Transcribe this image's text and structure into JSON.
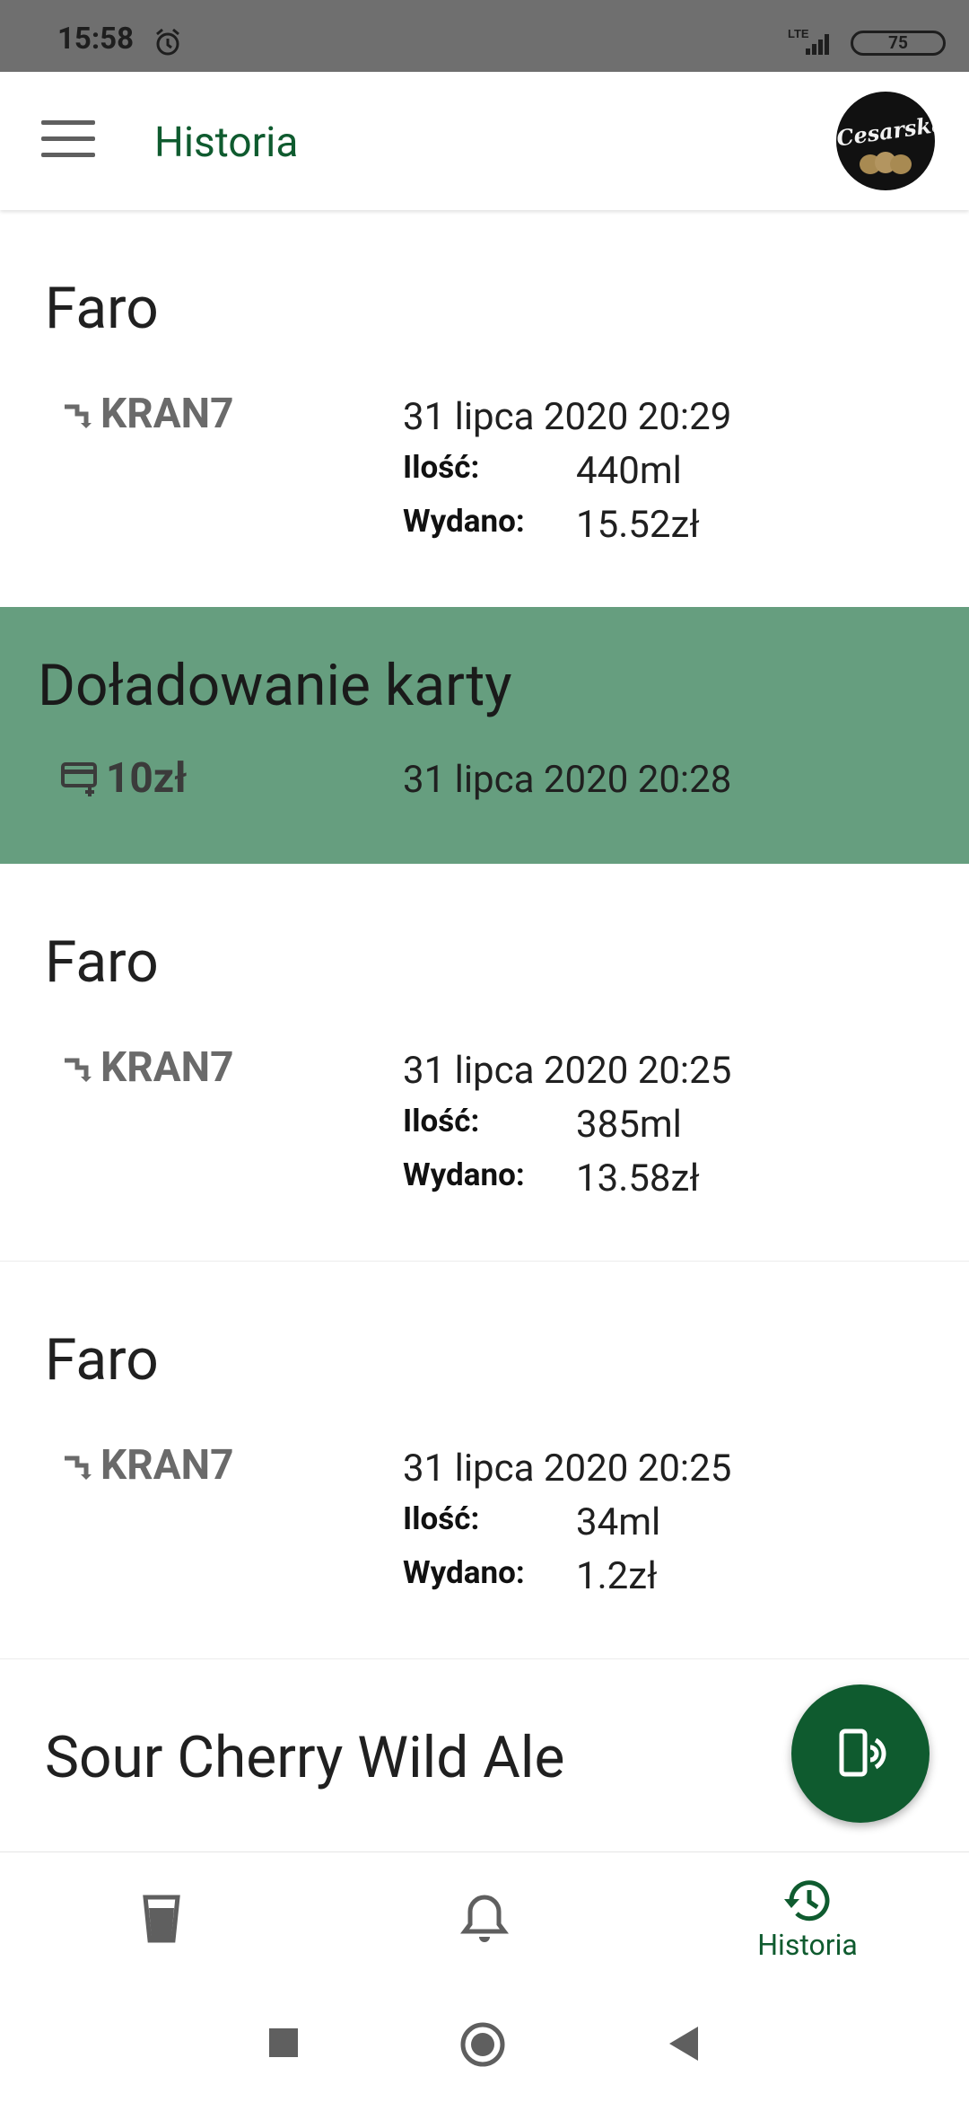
{
  "status": {
    "time": "15:58",
    "network": "LTE",
    "battery": "75"
  },
  "appbar": {
    "title": "Historia",
    "logo_text": "Cesarska"
  },
  "entries": [
    {
      "name": "Faro",
      "tap": "KRAN7",
      "date": "31 lipca 2020 20:29",
      "qty_label": "Ilość:",
      "qty": "440ml",
      "spent_label": "Wydano:",
      "spent": "15.52zł"
    },
    {
      "name": "Doładowanie karty",
      "amount": "10zł",
      "date": "31 lipca 2020 20:28"
    },
    {
      "name": "Faro",
      "tap": "KRAN7",
      "date": "31 lipca 2020 20:25",
      "qty_label": "Ilość:",
      "qty": "385ml",
      "spent_label": "Wydano:",
      "spent": "13.58zł"
    },
    {
      "name": "Faro",
      "tap": "KRAN7",
      "date": "31 lipca 2020 20:25",
      "qty_label": "Ilość:",
      "qty": "34ml",
      "spent_label": "Wydano:",
      "spent": "1.2zł"
    },
    {
      "name": "Sour Cherry Wild Ale"
    }
  ],
  "bottom_nav": {
    "history_label": "Historia"
  },
  "colors": {
    "brand": "#0f5b2f",
    "topup_bg": "#669e7f",
    "statusbar": "#6f6f6f"
  }
}
